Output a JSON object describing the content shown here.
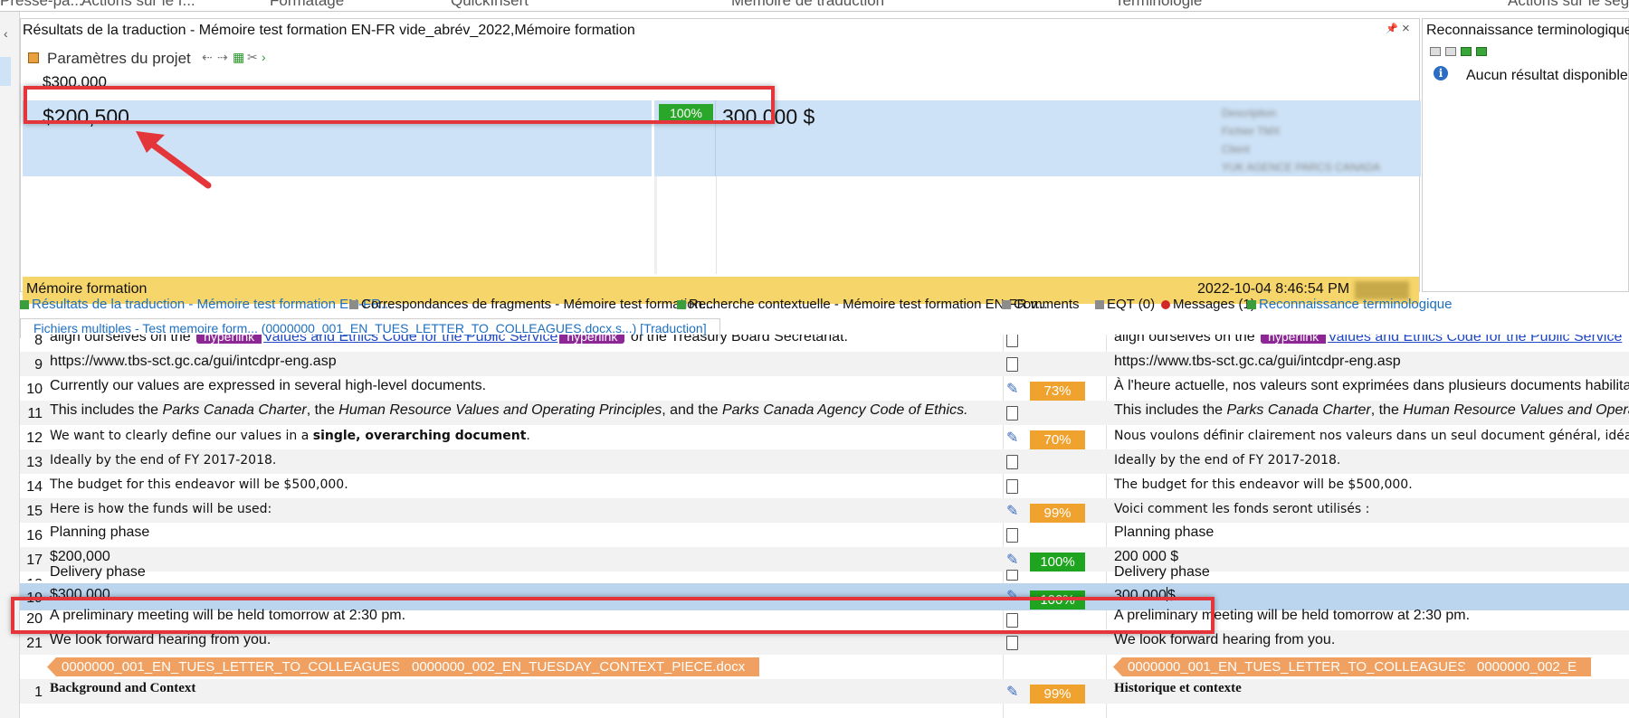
{
  "ribbon": {
    "groups": [
      "Presse-pa...",
      "Actions sur le f...",
      "Formatage",
      "QuickInsert",
      "Mémoire de traduction",
      "Terminologie",
      "Actions sur le segm"
    ]
  },
  "results_panel": {
    "title": "Résultats de la traduction - Mémoire test formation EN-FR vide_abrév_2022,Mémoire formation",
    "toolbar_label": "Paramètres du projet",
    "source_line": "$300,000",
    "match": {
      "source": "$200,500",
      "percent": "100%",
      "target": "300 000 $",
      "meta_blurred": [
        "Description",
        "Fichier TMX",
        "Client",
        "YUK AGENCE PARCS CANADA"
      ]
    },
    "tm_name": "Mémoire formation",
    "tm_date": "2022-10-04 8:46:54 PM",
    "tm_user": "l"
  },
  "term_panel": {
    "title": "Reconnaissance terminologique",
    "message": "Aucun résultat disponible."
  },
  "tabs": [
    {
      "label": "Résultats de la traduction - Mémoire test formation EN-FR...",
      "active": true
    },
    {
      "label": "Correspondances de fragments - Mémoire test formation..."
    },
    {
      "label": "Recherche contextuelle - Mémoire test formation EN-FR v..."
    },
    {
      "label": "Comments"
    },
    {
      "label": "EQT (0)"
    },
    {
      "label": "Messages (1)"
    },
    {
      "label": "Reconnaissance terminologique",
      "active": true
    }
  ],
  "document_tab": "Fichiers multiples - Test memoire form... (0000000_001_EN_TUES_LETTER_TO_COLLEAGUES.docx.s...) [Traduction]",
  "segments": {
    "s8": {
      "num": "8",
      "src_a": "align ourselves on the",
      "tag": "hyperlink",
      "link": "Values and Ethics Code for the Public Service",
      "src_b": "of the Treasury Board Secretariat.",
      "tgt_a": "align ourselves on the"
    },
    "s9": {
      "num": "9",
      "src": "https://www.tbs-sct.gc.ca/gui/intcdpr-eng.asp",
      "tgt": "https://www.tbs-sct.gc.ca/gui/intcdpr-eng.asp"
    },
    "s10": {
      "num": "10",
      "src": "Currently our values are expressed in several high-level documents.",
      "pct": "73%",
      "tgt": "À l'heure actuelle, nos valeurs sont exprimées dans plusieurs documents habilitants"
    },
    "s11": {
      "num": "11",
      "src_a": "This includes the",
      "src_i1": "Parks Canada Charter",
      "src_b": ", the",
      "src_i2": "Human Resource Values and Operating Principles",
      "src_c": ", and the",
      "src_i3": "Parks Canada Agency Code of Ethics.",
      "tgt_a": "This includes the",
      "tgt_i1": "Parks Canada Charter",
      "tgt_b": ", the",
      "tgt_i2": "Human Resource Values and Operati"
    },
    "s12": {
      "num": "12",
      "src_a": "We want to clearly define our values in a",
      "src_b": "single, overarching document",
      "src_c": ".",
      "pct": "70%",
      "tgt": "Nous voulons définir clairement nos valeurs dans un seul document général, idéalement d"
    },
    "s13": {
      "num": "13",
      "src": "Ideally by the end of FY 2017-2018.",
      "tgt": "Ideally by the end of FY 2017-2018."
    },
    "s14": {
      "num": "14",
      "src": "The budget for this endeavor will be $500,000.",
      "tgt": "The budget for this endeavor will be $500,000."
    },
    "s15": {
      "num": "15",
      "src": "Here is how the funds will be used:",
      "pct": "99%",
      "tgt": "Voici comment les fonds seront utilisés :"
    },
    "s16": {
      "num": "16",
      "src": "Planning phase",
      "tgt": "Planning phase"
    },
    "s17": {
      "num": "17",
      "src": "$200,000",
      "pct": "100%",
      "tgt": "200 000 $"
    },
    "s18": {
      "num": "18",
      "src": "Delivery phase",
      "tgt": "Delivery phase"
    },
    "s19": {
      "num": "19",
      "src": "$300,000",
      "pct": "100%",
      "tgt_a": "300 000",
      "tgt_b": "$"
    },
    "s20": {
      "num": "20",
      "src": "A preliminary meeting will be held tomorrow at 2:30 pm.",
      "tgt": "A preliminary meeting will be held tomorrow at 2:30 pm."
    },
    "s21": {
      "num": "21",
      "src": "We look forward hearing from you.",
      "tgt": "We look forward hearing from you."
    },
    "files": [
      "0000000_001_EN_TUES_LETTER_TO_COLLEAGUES.docx",
      "0000000_002_EN_TUESDAY_CONTEXT_PIECE.docx",
      "0000000_001_EN_TUES_LETTER_TO_COLLEAGUES.docx",
      "0000000_002_E"
    ],
    "s1": {
      "num": "1",
      "src": "Background and Context",
      "pct": "99%",
      "tgt": "Historique et contexte"
    }
  },
  "colors": {
    "accent": "#1e6fc0",
    "match_green": "#1ea41e",
    "fuzzy_orange": "#f0a22e",
    "tm_bar": "#f6d56a",
    "highlight_red": "#e3353a"
  }
}
